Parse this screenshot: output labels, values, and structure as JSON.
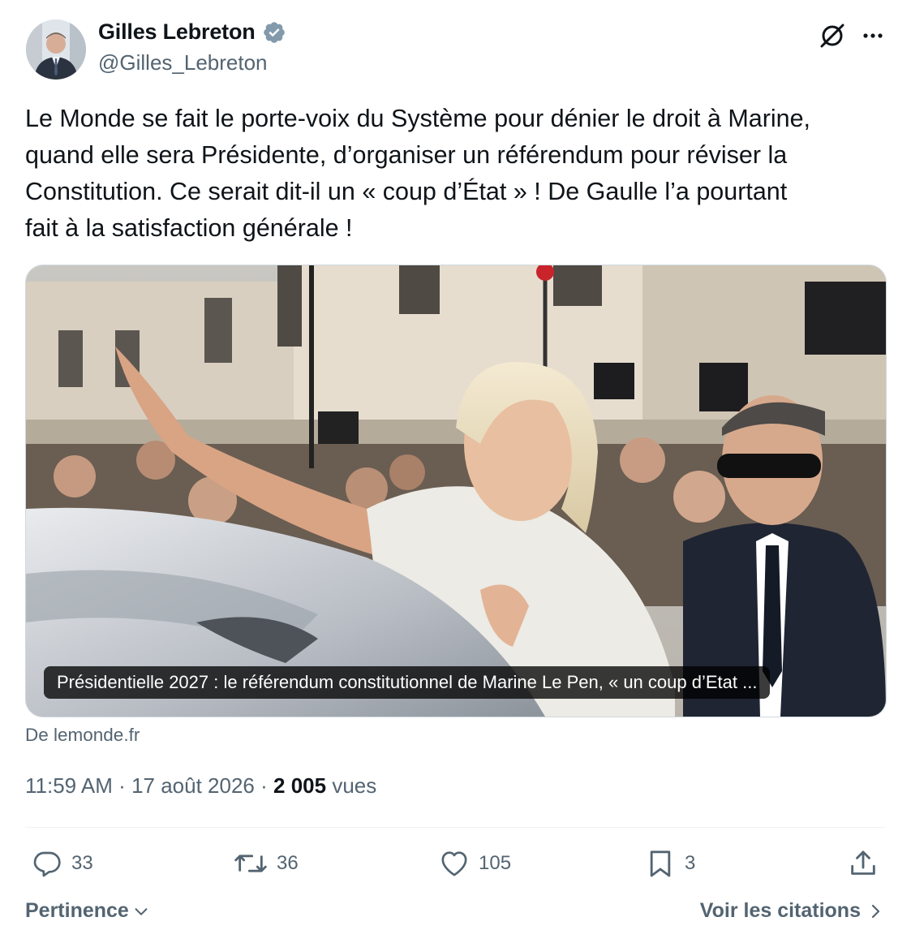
{
  "author": {
    "name": "Gilles Lebreton",
    "handle": "@Gilles_Lebreton",
    "verified": true
  },
  "tweet": {
    "text": "Le Monde se fait le porte-voix du Système pour dénier le droit à Marine,\nquand elle sera Présidente, d’organiser un référendum pour réviser la\nConstitution. Ce serait dit-il un « coup d’État » ! De Gaulle l’a pourtant\nfait à la satisfaction générale !"
  },
  "card": {
    "caption": "Présidentielle 2027 : le référendum constitutionnel de Marine Le Pen, « un coup d’Etat ...",
    "source": "De lemonde.fr"
  },
  "meta": {
    "time": "11:59 AM",
    "separator": "·",
    "date": "17 août 2026",
    "views_count": "2 005",
    "views_label": "vues"
  },
  "actions": {
    "replies": "33",
    "reposts": "36",
    "likes": "105",
    "bookmarks": "3"
  },
  "footer": {
    "sort_label": "Pertinence",
    "quotes_label": "Voir les citations"
  },
  "colors": {
    "text": "#0f1419",
    "secondary": "#536471",
    "verified_badge": "#829aab",
    "divider": "#eff3f4"
  },
  "icons": [
    "verified-badge-icon",
    "grok-icon",
    "more-icon",
    "reply-icon",
    "repost-icon",
    "like-icon",
    "bookmark-icon",
    "share-icon",
    "chevron-down-icon",
    "chevron-right-icon"
  ]
}
